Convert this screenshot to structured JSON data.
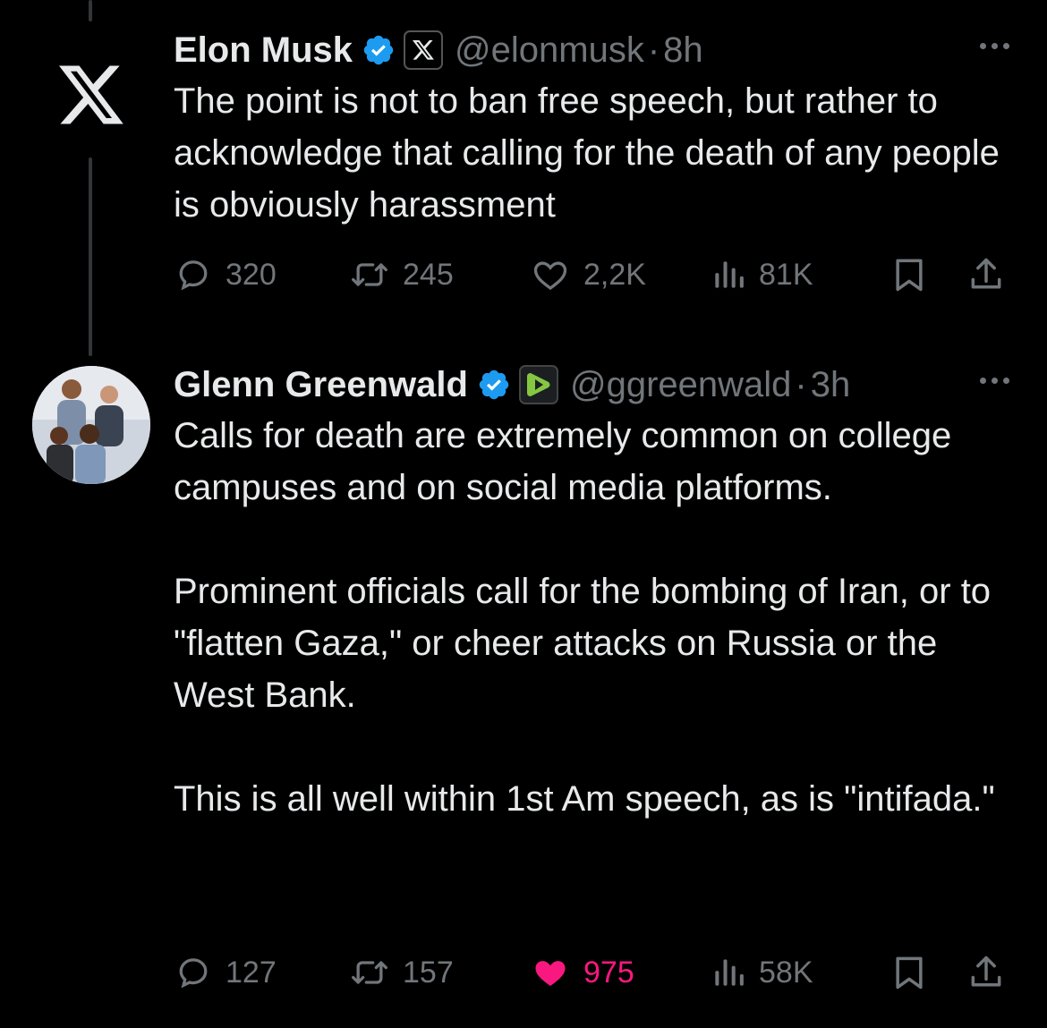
{
  "tweets": [
    {
      "name": "Elon Musk",
      "handle": "@elonmusk",
      "separator": "·",
      "time": "8h",
      "verified": true,
      "affiliation_icon": "x-logo-icon",
      "text": [
        "The point is not to ban free speech, but rather to acknowledge that calling for the death of any people is obviously harassment"
      ],
      "actions": {
        "replies": "320",
        "reposts": "245",
        "likes": "2,2K",
        "views": "81K",
        "liked": false
      }
    },
    {
      "name": "Glenn Greenwald",
      "handle": "@ggreenwald",
      "separator": "·",
      "time": "3h",
      "verified": true,
      "affiliation_icon": "rumble-icon",
      "text": [
        "Calls for death are extremely common on college campuses and on social media platforms.",
        "Prominent officials call for the bombing of Iran, or to \"flatten Gaza,\" or cheer attacks on Russia or the West Bank.",
        "This is all well within 1st Am speech, as is \"intifada.\""
      ],
      "actions": {
        "replies": "127",
        "reposts": "157",
        "likes": "975",
        "views": "58K",
        "liked": true
      }
    }
  ],
  "colors": {
    "background": "#000000",
    "text": "#e7e9ea",
    "muted": "#71767b",
    "verified": "#1d9bf0",
    "like": "#f91880",
    "rumble": "#85c742"
  }
}
